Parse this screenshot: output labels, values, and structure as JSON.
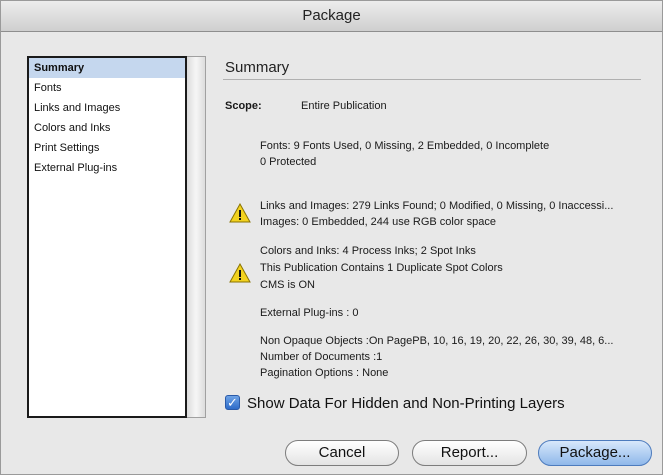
{
  "window": {
    "title": "Package"
  },
  "sidebar": {
    "items": [
      {
        "label": "Summary",
        "selected": true
      },
      {
        "label": "Fonts"
      },
      {
        "label": "Links and Images"
      },
      {
        "label": "Colors and Inks"
      },
      {
        "label": "Print Settings"
      },
      {
        "label": "External Plug-ins"
      }
    ]
  },
  "summary": {
    "title": "Summary",
    "scope_label": "Scope:",
    "scope_value": "Entire Publication",
    "fonts_line1": "Fonts: 9 Fonts Used, 0 Missing, 2 Embedded, 0 Incomplete",
    "fonts_line2": "0 Protected",
    "links_line1": "Links and Images: 279 Links Found; 0 Modified, 0 Missing, 0 Inaccessi...",
    "links_line2": "Images: 0 Embedded, 244 use RGB color space",
    "colors_line1": "Colors and Inks: 4 Process Inks; 2 Spot Inks",
    "colors_line2": "This Publication Contains 1 Duplicate Spot Colors",
    "colors_line3": "CMS is ON",
    "plugins_line": "External Plug-ins : 0",
    "other_line1": "Non Opaque Objects :On PagePB, 10, 16, 19, 20, 22, 26, 30, 39, 48, 6...",
    "other_line2": "Number of Documents :1",
    "other_line3": "Pagination Options : None"
  },
  "options": {
    "show_hidden_label": "Show Data For Hidden and Non-Printing Layers",
    "show_hidden_checked": true
  },
  "buttons": {
    "cancel": "Cancel",
    "report": "Report...",
    "package": "Package..."
  },
  "icons": {
    "warning": "warning-icon",
    "check": "checkmark-icon"
  },
  "colors": {
    "selection": "#c5d7ee",
    "accent": "#4d7bbd",
    "warning": "#f2d21e"
  }
}
